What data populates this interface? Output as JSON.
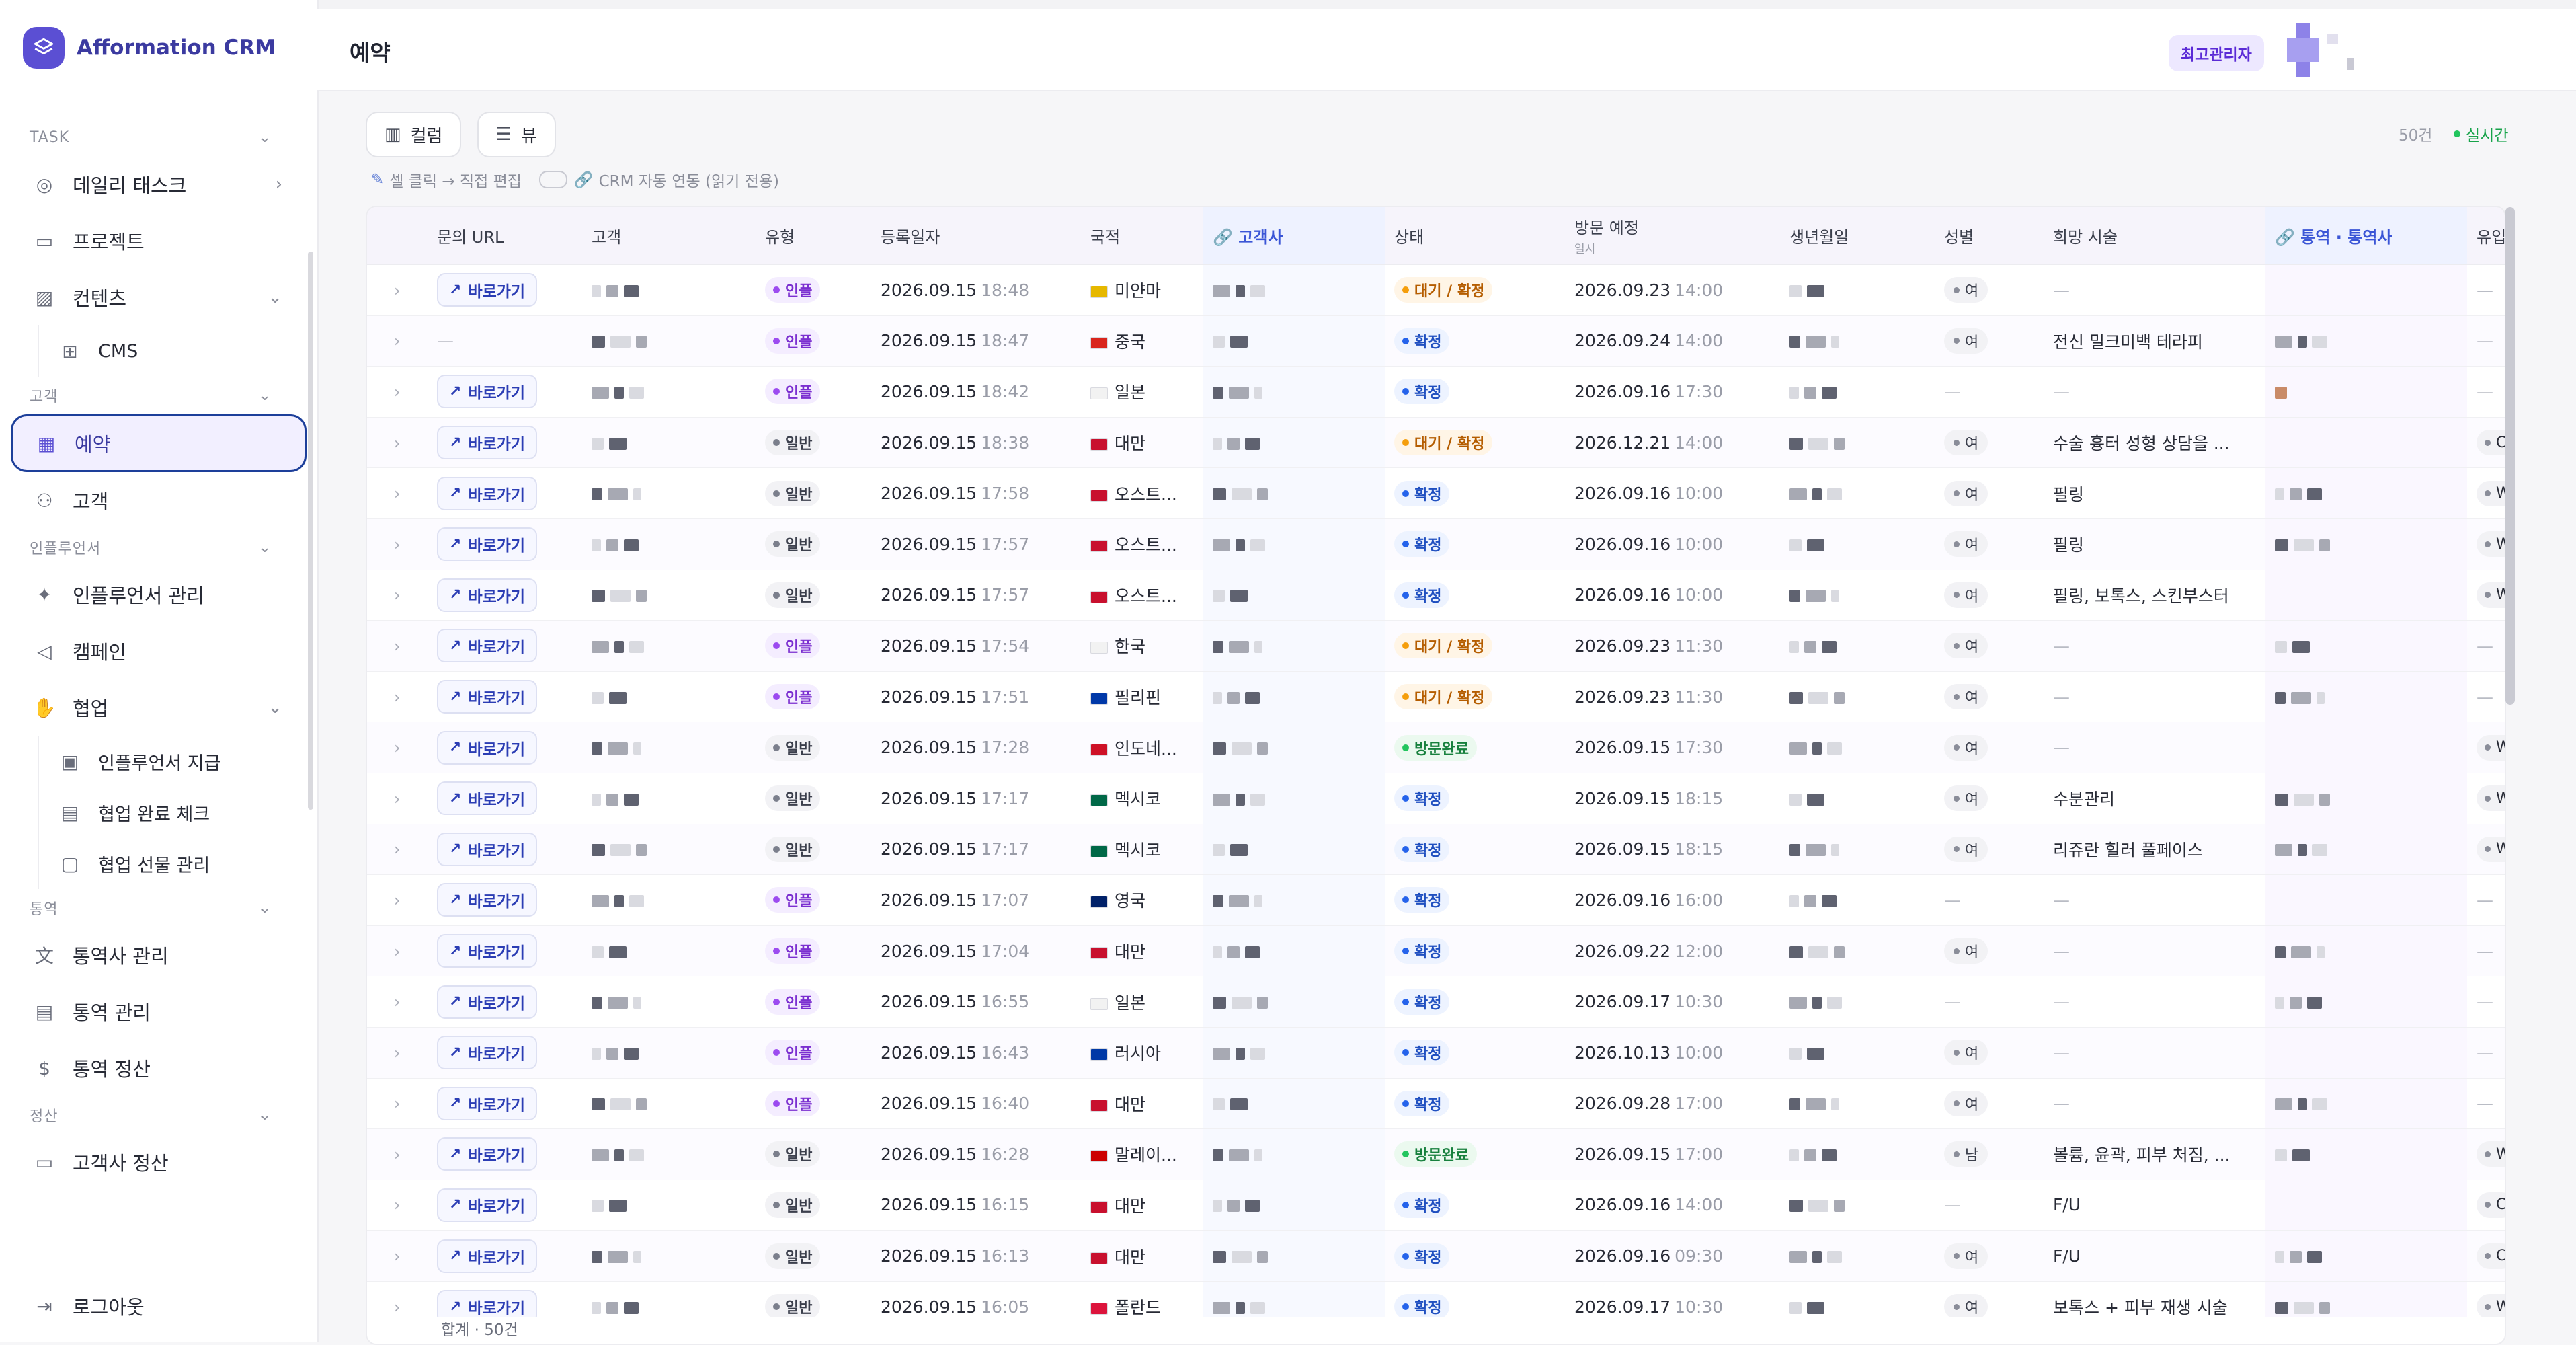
{
  "brand": {
    "name": "Afformation CRM"
  },
  "sidebar": {
    "groups": [
      {
        "label": "TASK"
      },
      {
        "label": "고객"
      },
      {
        "label": "인플루언서"
      },
      {
        "label": "통역"
      },
      {
        "label": "정산"
      }
    ],
    "items": {
      "daily": "데일리 태스크",
      "project": "프로젝트",
      "contents": "컨텐츠",
      "cms": "CMS",
      "reservation": "예약",
      "customer": "고객",
      "influencer_mgmt": "인플루언서 관리",
      "campaign": "캠페인",
      "collab": "협업",
      "infl_payment": "인플루언서 지급",
      "collab_check": "협업 완료 체크",
      "collab_gift": "협업 선물 관리",
      "interp_company": "통역사 관리",
      "interp_mgmt": "통역 관리",
      "interp_settle": "통역 정산",
      "client_settle": "고객사 정산",
      "logout": "로그아웃"
    }
  },
  "header": {
    "title": "예약",
    "role": "최고관리자"
  },
  "toolbar": {
    "columns": "컬럼",
    "view": "뷰",
    "hint_edit": "셀 클릭 → 직접 편집",
    "hint_sync": "CRM 자동 연동 (읽기 전용)",
    "count": "50건",
    "live": "실시간"
  },
  "table": {
    "headers": {
      "url": "문의 URL",
      "customer": "고객",
      "type": "유형",
      "created": "등록일자",
      "nation": "국적",
      "client": "고객사",
      "status": "상태",
      "visit": "방문 예정",
      "visit_sub": "일시",
      "birth": "생년월일",
      "gender": "성별",
      "treatment": "희망 시술",
      "interp": "통역 · 통역사",
      "channel": "유입 경로"
    },
    "go_label": "바로가기",
    "rows": [
      {
        "url": true,
        "type": "인플",
        "created_d": "2026.09.15",
        "created_t": "18:48",
        "nation": "미얀마",
        "flag": "#e6b800",
        "status": "대기 / 확정",
        "status_kind": "wait",
        "visit_d": "2026.09.23",
        "visit_t": "14:00",
        "gender": "여",
        "treatment": "—",
        "channel": "—"
      },
      {
        "url": false,
        "type": "인플",
        "created_d": "2026.09.15",
        "created_t": "18:47",
        "nation": "중국",
        "flag": "#d9251d",
        "status": "확정",
        "status_kind": "confirm",
        "visit_d": "2026.09.24",
        "visit_t": "14:00",
        "gender": "여",
        "treatment": "전신 밀크미백 테라피",
        "channel": "—"
      },
      {
        "url": true,
        "type": "인플",
        "created_d": "2026.09.15",
        "created_t": "18:42",
        "nation": "일본",
        "flag": "#f2f2f2",
        "status": "확정",
        "status_kind": "confirm",
        "visit_d": "2026.09.16",
        "visit_t": "17:30",
        "gender": "—",
        "treatment": "—",
        "channel": "—"
      },
      {
        "url": true,
        "type": "일반",
        "created_d": "2026.09.15",
        "created_t": "18:38",
        "nation": "대만",
        "flag": "#c8102e",
        "status": "대기 / 확정",
        "status_kind": "wait",
        "visit_d": "2026.12.21",
        "visit_t": "14:00",
        "gender": "여",
        "treatment": "수술 흉터 성형 상담을 ...",
        "channel": "C"
      },
      {
        "url": true,
        "type": "일반",
        "created_d": "2026.09.15",
        "created_t": "17:58",
        "nation": "오스트...",
        "flag": "#c8102e",
        "status": "확정",
        "status_kind": "confirm",
        "visit_d": "2026.09.16",
        "visit_t": "10:00",
        "gender": "여",
        "treatment": "필링",
        "channel": "W"
      },
      {
        "url": true,
        "type": "일반",
        "created_d": "2026.09.15",
        "created_t": "17:57",
        "nation": "오스트...",
        "flag": "#c8102e",
        "status": "확정",
        "status_kind": "confirm",
        "visit_d": "2026.09.16",
        "visit_t": "10:00",
        "gender": "여",
        "treatment": "필링",
        "channel": "W"
      },
      {
        "url": true,
        "type": "일반",
        "created_d": "2026.09.15",
        "created_t": "17:57",
        "nation": "오스트...",
        "flag": "#c8102e",
        "status": "확정",
        "status_kind": "confirm",
        "visit_d": "2026.09.16",
        "visit_t": "10:00",
        "gender": "여",
        "treatment": "필링, 보톡스, 스킨부스터",
        "channel": "W"
      },
      {
        "url": true,
        "type": "인플",
        "created_d": "2026.09.15",
        "created_t": "17:54",
        "nation": "한국",
        "flag": "#f2f2f2",
        "status": "대기 / 확정",
        "status_kind": "wait",
        "visit_d": "2026.09.23",
        "visit_t": "11:30",
        "gender": "여",
        "treatment": "—",
        "channel": "—"
      },
      {
        "url": true,
        "type": "인플",
        "created_d": "2026.09.15",
        "created_t": "17:51",
        "nation": "필리핀",
        "flag": "#0038a8",
        "status": "대기 / 확정",
        "status_kind": "wait",
        "visit_d": "2026.09.23",
        "visit_t": "11:30",
        "gender": "여",
        "treatment": "—",
        "channel": "—"
      },
      {
        "url": true,
        "type": "일반",
        "created_d": "2026.09.15",
        "created_t": "17:28",
        "nation": "인도네...",
        "flag": "#ce1126",
        "status": "방문완료",
        "status_kind": "done",
        "visit_d": "2026.09.15",
        "visit_t": "17:30",
        "gender": "여",
        "treatment": "—",
        "channel": "W"
      },
      {
        "url": true,
        "type": "일반",
        "created_d": "2026.09.15",
        "created_t": "17:17",
        "nation": "멕시코",
        "flag": "#006847",
        "status": "확정",
        "status_kind": "confirm",
        "visit_d": "2026.09.15",
        "visit_t": "18:15",
        "gender": "여",
        "treatment": "수분관리",
        "channel": "W"
      },
      {
        "url": true,
        "type": "일반",
        "created_d": "2026.09.15",
        "created_t": "17:17",
        "nation": "멕시코",
        "flag": "#006847",
        "status": "확정",
        "status_kind": "confirm",
        "visit_d": "2026.09.15",
        "visit_t": "18:15",
        "gender": "여",
        "treatment": "리쥬란 힐러 풀페이스",
        "channel": "W"
      },
      {
        "url": true,
        "type": "인플",
        "created_d": "2026.09.15",
        "created_t": "17:07",
        "nation": "영국",
        "flag": "#012169",
        "status": "확정",
        "status_kind": "confirm",
        "visit_d": "2026.09.16",
        "visit_t": "16:00",
        "gender": "—",
        "treatment": "—",
        "channel": "—"
      },
      {
        "url": true,
        "type": "인플",
        "created_d": "2026.09.15",
        "created_t": "17:04",
        "nation": "대만",
        "flag": "#c8102e",
        "status": "확정",
        "status_kind": "confirm",
        "visit_d": "2026.09.22",
        "visit_t": "12:00",
        "gender": "여",
        "treatment": "—",
        "channel": "—"
      },
      {
        "url": true,
        "type": "인플",
        "created_d": "2026.09.15",
        "created_t": "16:55",
        "nation": "일본",
        "flag": "#f2f2f2",
        "status": "확정",
        "status_kind": "confirm",
        "visit_d": "2026.09.17",
        "visit_t": "10:30",
        "gender": "—",
        "treatment": "—",
        "channel": "—"
      },
      {
        "url": true,
        "type": "인플",
        "created_d": "2026.09.15",
        "created_t": "16:43",
        "nation": "러시아",
        "flag": "#0039a6",
        "status": "확정",
        "status_kind": "confirm",
        "visit_d": "2026.10.13",
        "visit_t": "10:00",
        "gender": "여",
        "treatment": "—",
        "channel": "—"
      },
      {
        "url": true,
        "type": "인플",
        "created_d": "2026.09.15",
        "created_t": "16:40",
        "nation": "대만",
        "flag": "#c8102e",
        "status": "확정",
        "status_kind": "confirm",
        "visit_d": "2026.09.28",
        "visit_t": "17:00",
        "gender": "여",
        "treatment": "—",
        "channel": "—"
      },
      {
        "url": true,
        "type": "일반",
        "created_d": "2026.09.15",
        "created_t": "16:28",
        "nation": "말레이...",
        "flag": "#cc0001",
        "status": "방문완료",
        "status_kind": "done",
        "visit_d": "2026.09.15",
        "visit_t": "17:00",
        "gender": "남",
        "treatment": "볼륨, 윤곽, 피부 처짐, ...",
        "channel": "W"
      },
      {
        "url": true,
        "type": "일반",
        "created_d": "2026.09.15",
        "created_t": "16:15",
        "nation": "대만",
        "flag": "#c8102e",
        "status": "확정",
        "status_kind": "confirm",
        "visit_d": "2026.09.16",
        "visit_t": "14:00",
        "gender": "—",
        "treatment": "F/U",
        "channel": "C"
      },
      {
        "url": true,
        "type": "일반",
        "created_d": "2026.09.15",
        "created_t": "16:13",
        "nation": "대만",
        "flag": "#c8102e",
        "status": "확정",
        "status_kind": "confirm",
        "visit_d": "2026.09.16",
        "visit_t": "09:30",
        "gender": "여",
        "treatment": "F/U",
        "channel": "C"
      },
      {
        "url": true,
        "type": "일반",
        "created_d": "2026.09.15",
        "created_t": "16:05",
        "nation": "폴란드",
        "flag": "#dc143c",
        "status": "확정",
        "status_kind": "confirm",
        "visit_d": "2026.09.17",
        "visit_t": "10:30",
        "gender": "여",
        "treatment": "보톡스 + 피부 재생 시술",
        "channel": "W"
      }
    ],
    "footer": "합계 · 50건"
  }
}
